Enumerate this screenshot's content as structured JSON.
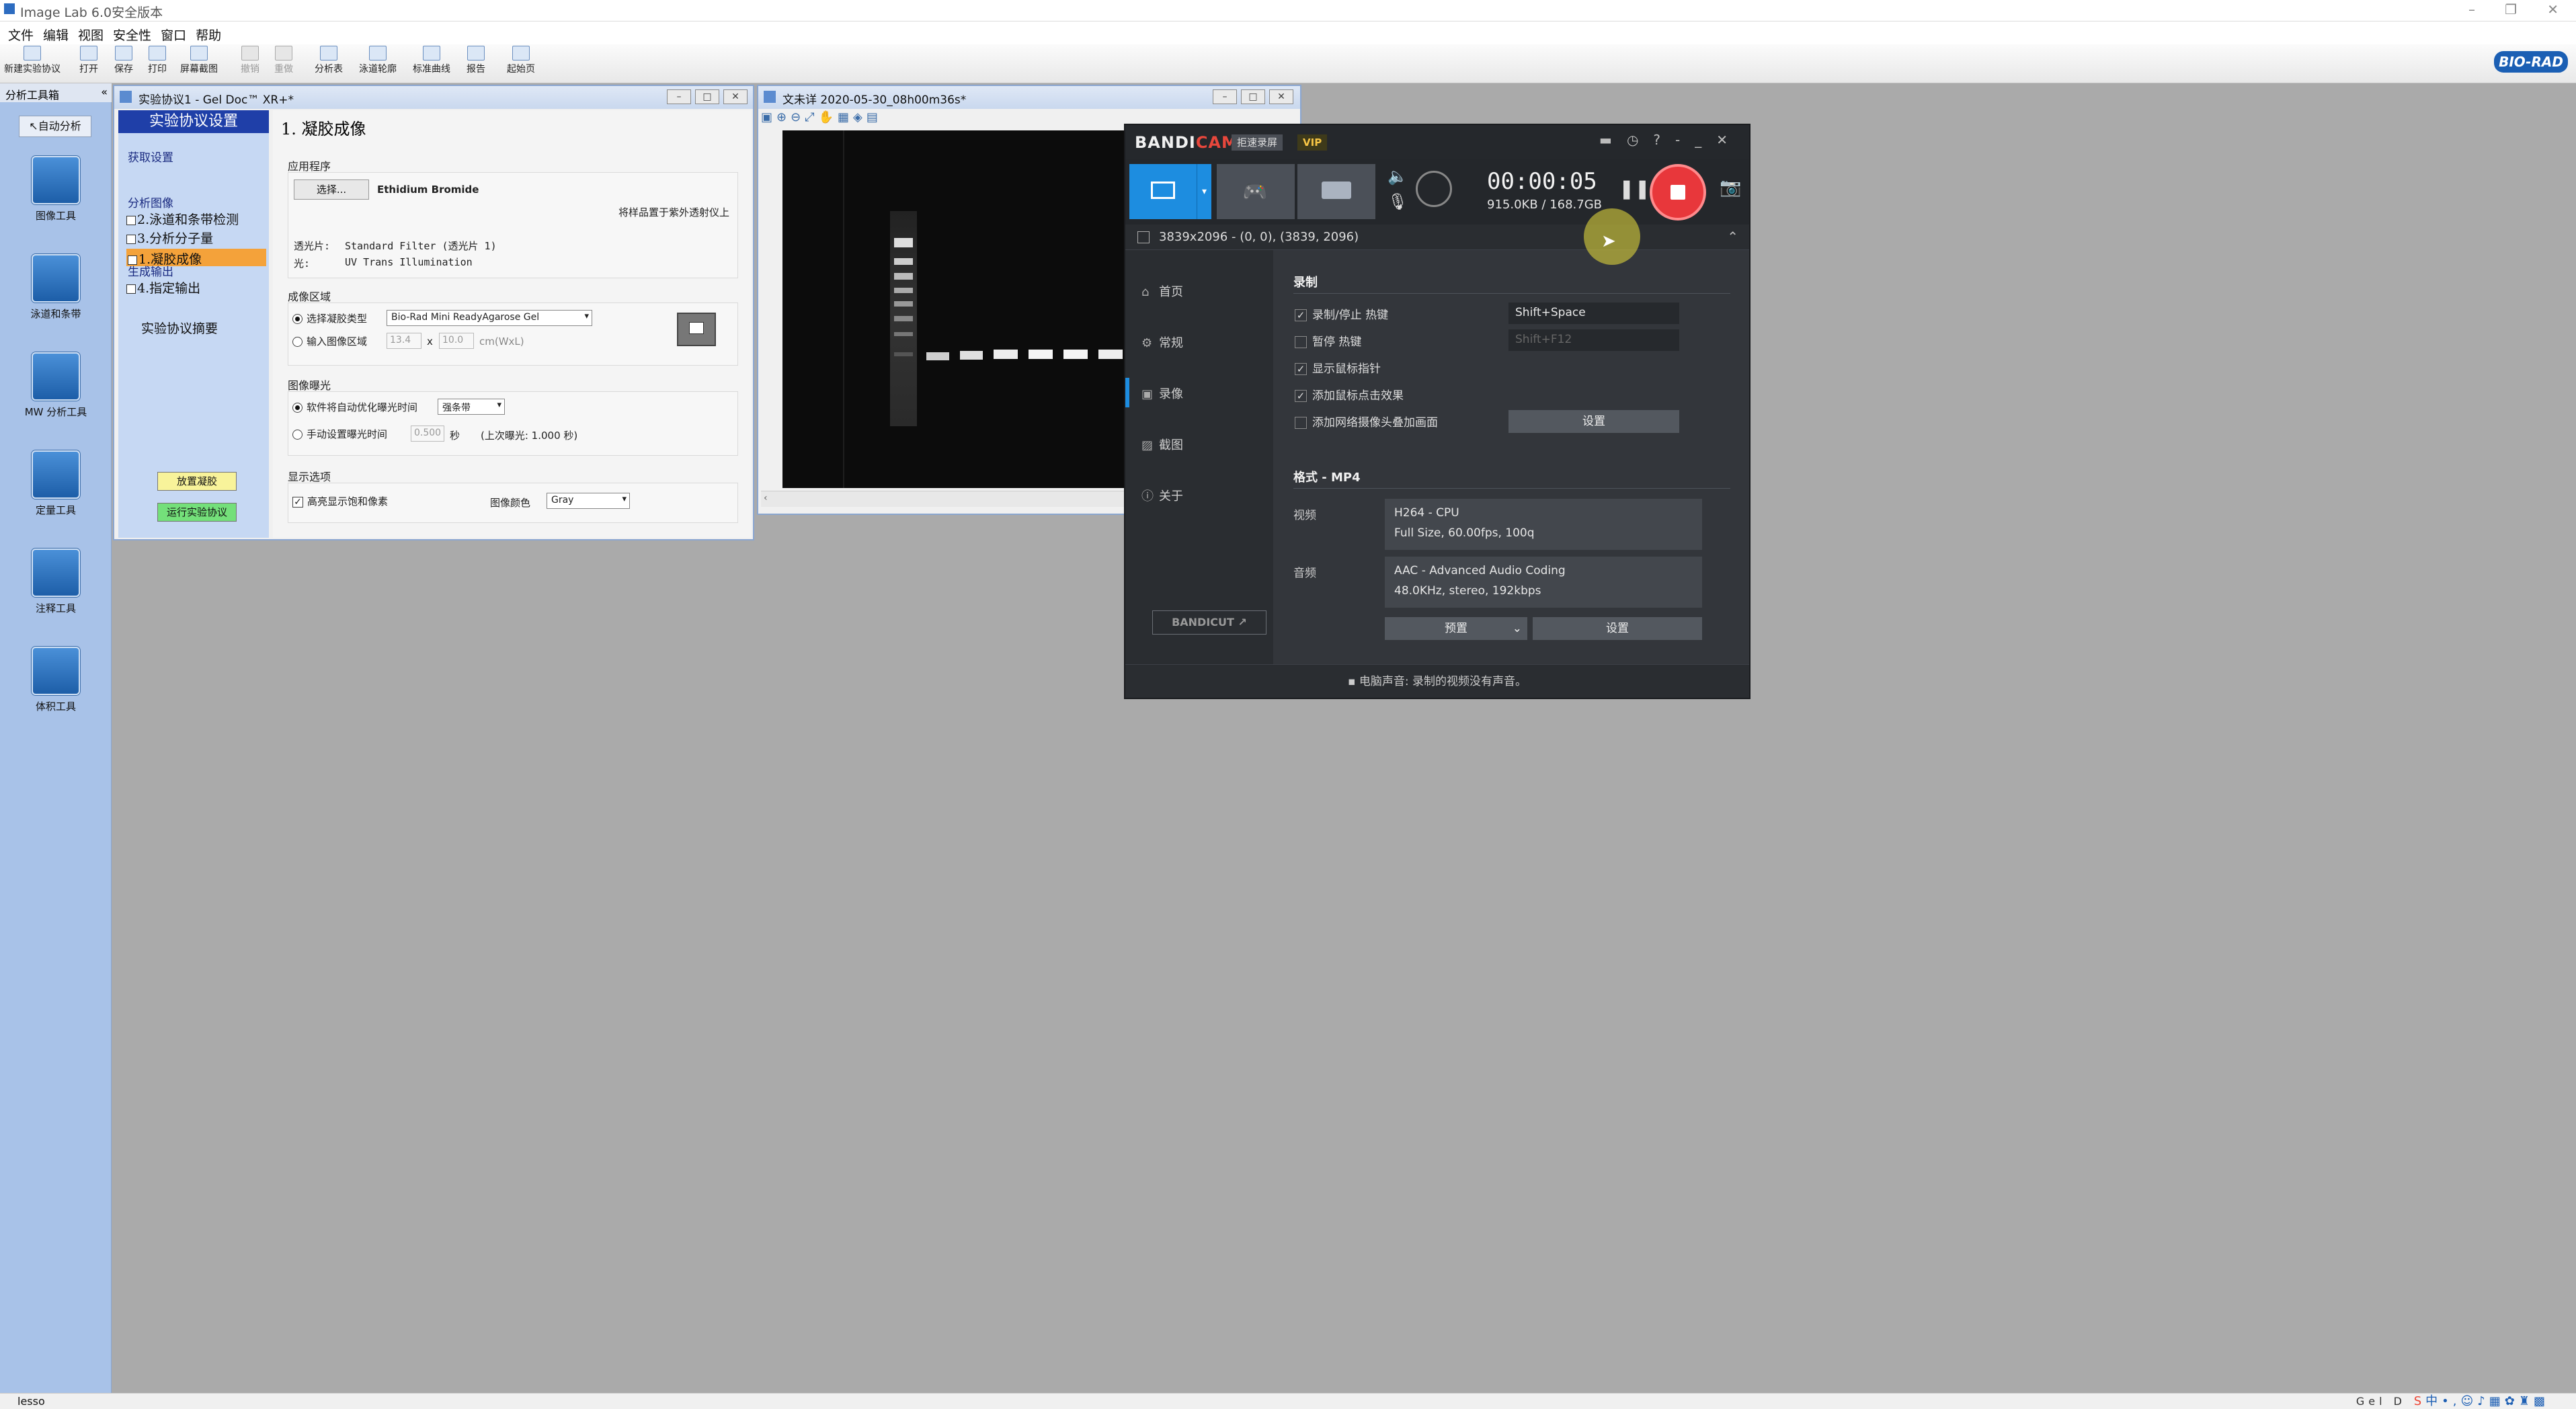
{
  "app": {
    "title": "Image Lab 6.0安全版本"
  },
  "menu": [
    "文件",
    "编辑",
    "视图",
    "安全性",
    "窗口",
    "帮助"
  ],
  "toolbar": [
    {
      "label": "新建实验协议",
      "enabled": true
    },
    {
      "label": "打开",
      "enabled": true
    },
    {
      "label": "保存",
      "enabled": true
    },
    {
      "label": "打印",
      "enabled": true
    },
    {
      "label": "屏幕截图",
      "enabled": true
    },
    {
      "label": "撤销",
      "enabled": false
    },
    {
      "label": "重做",
      "enabled": false
    },
    {
      "label": "分析表",
      "enabled": true
    },
    {
      "label": "泳道轮廓",
      "enabled": true
    },
    {
      "label": "标准曲线",
      "enabled": true
    },
    {
      "label": "报告",
      "enabled": true
    },
    {
      "label": "起始页",
      "enabled": true
    }
  ],
  "brand": "BIO-RAD",
  "left_panel": {
    "header": "分析工具箱",
    "auto_button": "自动分析",
    "tools": [
      "图像工具",
      "泳道和条带",
      "MW 分析工具",
      "定量工具",
      "注释工具",
      "体积工具"
    ]
  },
  "protocol_window": {
    "title": "实验协议1 - Gel Doc™ XR+*",
    "sidebar": {
      "header": "实验协议设置",
      "acquire": "获取设置",
      "step1": "1.凝胶成像",
      "analyze": "分析图像",
      "step2": "2.泳道和条带检测",
      "step3": "3.分析分子量",
      "output": "生成输出",
      "step4": "4.指定输出",
      "summary": "实验协议摘要",
      "place_gel": "放置凝胶",
      "run_protocol": "运行实验协议"
    },
    "main": {
      "title": "1. 凝胶成像",
      "application": {
        "label": "应用程序",
        "select_button": "选择...",
        "selected_app": "Ethidium Bromide",
        "note": "将样品置于紫外透射仪上",
        "filter_label": "透光片:",
        "filter_value": "Standard Filter (透光片 1)",
        "light_label": "光:",
        "light_value": "UV Trans Illumination"
      },
      "imaging_area": {
        "label": "成像区域",
        "option1": "选择凝胶类型",
        "gel_type": "Bio-Rad Mini ReadyAgarose Gel",
        "option2": "输入图像区域",
        "width": "13.4",
        "x": "x",
        "height": "10.0",
        "unit": "cm(WxL)"
      },
      "exposure": {
        "label": "图像曝光",
        "option1": "软件将自动优化曝光时间",
        "auto_mode": "强条带",
        "option2": "手动设置曝光时间",
        "manual_value": "0.500",
        "unit": "秒",
        "last": "(上次曝光: 1.000 秒)"
      },
      "display": {
        "label": "显示选项",
        "highlight": "高亮显示饱和像素",
        "color_label": "图像颜色",
        "color_value": "Gray"
      }
    }
  },
  "image_window": {
    "title": "文未详 2020-05-30_08h00m36s*",
    "bands": 6
  },
  "bandicam": {
    "logo_a": "BANDI",
    "logo_b": "CAM",
    "mode": "拒速录屏",
    "vip": "VIP",
    "timer": "00:00:05",
    "size": "915.0KB / 168.7GB",
    "region": "3839x2096 - (0, 0), (3839, 2096)",
    "nav": [
      "首页",
      "常规",
      "录像",
      "截图",
      "关于"
    ],
    "bandicut": "BANDICUT ↗",
    "record_section": "录制",
    "record_options": [
      {
        "label": "录制/停止 热键",
        "checked": true
      },
      {
        "label": "暂停 热键",
        "checked": false
      },
      {
        "label": "显示鼠标指针",
        "checked": true
      },
      {
        "label": "添加鼠标点击效果",
        "checked": true
      },
      {
        "label": "添加网络摄像头叠加画面",
        "checked": false
      }
    ],
    "hotkey_record": "Shift+Space",
    "hotkey_pause": "Shift+F12",
    "settings_button": "设置",
    "format_section": "格式 - MP4",
    "video_label": "视频",
    "video_line1": "H264 - CPU",
    "video_line2": "Full Size, 60.00fps, 100q",
    "audio_label": "音频",
    "audio_line1": "AAC - Advanced Audio Coding",
    "audio_line2": "48.0KHz, stereo, 192kbps",
    "preset_button": "预置",
    "format_settings_button": "设置",
    "footer": "电脑声音: 录制的视频没有声音。"
  },
  "status": {
    "text": "lesso",
    "tray_text": "Gel D"
  }
}
